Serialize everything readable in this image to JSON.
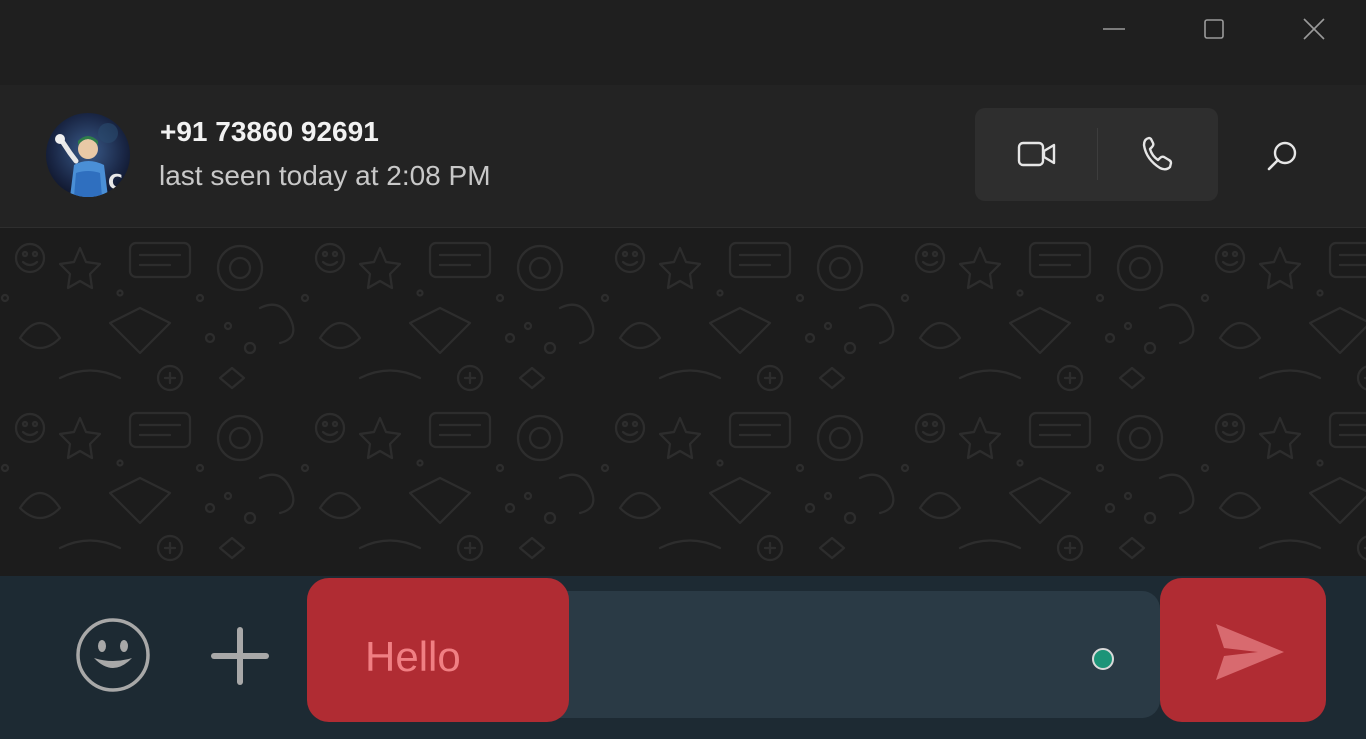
{
  "titlebar": {
    "icons": [
      "minimize-icon",
      "maximize-icon",
      "close-icon"
    ]
  },
  "contact": {
    "name": "+91 73860 92691",
    "status": "last seen today at 2:08 PM",
    "avatar_icon": "avatar"
  },
  "header_actions": {
    "icons": [
      "video-camera-icon",
      "phone-icon",
      "search-icon"
    ]
  },
  "composer": {
    "message_text": "Hello",
    "icons": [
      "emoji-icon",
      "plus-icon",
      "send-icon"
    ]
  },
  "colors": {
    "highlight": "#b02c33",
    "composer_background": "#1d2a33",
    "input_background": "#2a3a45",
    "status_dot": "#1c9478"
  }
}
